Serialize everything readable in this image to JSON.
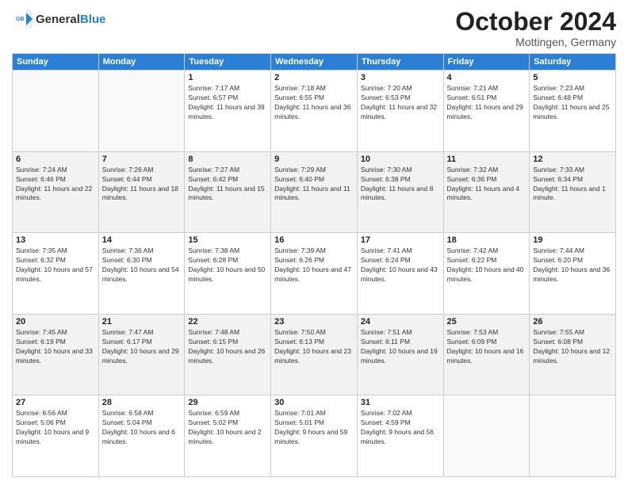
{
  "header": {
    "logo_general": "General",
    "logo_blue": "Blue",
    "month_title": "October 2024",
    "location": "Mottingen, Germany"
  },
  "weekdays": [
    "Sunday",
    "Monday",
    "Tuesday",
    "Wednesday",
    "Thursday",
    "Friday",
    "Saturday"
  ],
  "weeks": [
    [
      {
        "day": "",
        "sunrise": "",
        "sunset": "",
        "daylight": ""
      },
      {
        "day": "",
        "sunrise": "",
        "sunset": "",
        "daylight": ""
      },
      {
        "day": "1",
        "sunrise": "Sunrise: 7:17 AM",
        "sunset": "Sunset: 6:57 PM",
        "daylight": "Daylight: 11 hours and 39 minutes."
      },
      {
        "day": "2",
        "sunrise": "Sunrise: 7:18 AM",
        "sunset": "Sunset: 6:55 PM",
        "daylight": "Daylight: 11 hours and 36 minutes."
      },
      {
        "day": "3",
        "sunrise": "Sunrise: 7:20 AM",
        "sunset": "Sunset: 6:53 PM",
        "daylight": "Daylight: 11 hours and 32 minutes."
      },
      {
        "day": "4",
        "sunrise": "Sunrise: 7:21 AM",
        "sunset": "Sunset: 6:51 PM",
        "daylight": "Daylight: 11 hours and 29 minutes."
      },
      {
        "day": "5",
        "sunrise": "Sunrise: 7:23 AM",
        "sunset": "Sunset: 6:48 PM",
        "daylight": "Daylight: 11 hours and 25 minutes."
      }
    ],
    [
      {
        "day": "6",
        "sunrise": "Sunrise: 7:24 AM",
        "sunset": "Sunset: 6:46 PM",
        "daylight": "Daylight: 11 hours and 22 minutes."
      },
      {
        "day": "7",
        "sunrise": "Sunrise: 7:26 AM",
        "sunset": "Sunset: 6:44 PM",
        "daylight": "Daylight: 11 hours and 18 minutes."
      },
      {
        "day": "8",
        "sunrise": "Sunrise: 7:27 AM",
        "sunset": "Sunset: 6:42 PM",
        "daylight": "Daylight: 11 hours and 15 minutes."
      },
      {
        "day": "9",
        "sunrise": "Sunrise: 7:29 AM",
        "sunset": "Sunset: 6:40 PM",
        "daylight": "Daylight: 11 hours and 11 minutes."
      },
      {
        "day": "10",
        "sunrise": "Sunrise: 7:30 AM",
        "sunset": "Sunset: 6:38 PM",
        "daylight": "Daylight: 11 hours and 8 minutes."
      },
      {
        "day": "11",
        "sunrise": "Sunrise: 7:32 AM",
        "sunset": "Sunset: 6:36 PM",
        "daylight": "Daylight: 11 hours and 4 minutes."
      },
      {
        "day": "12",
        "sunrise": "Sunrise: 7:33 AM",
        "sunset": "Sunset: 6:34 PM",
        "daylight": "Daylight: 11 hours and 1 minute."
      }
    ],
    [
      {
        "day": "13",
        "sunrise": "Sunrise: 7:35 AM",
        "sunset": "Sunset: 6:32 PM",
        "daylight": "Daylight: 10 hours and 57 minutes."
      },
      {
        "day": "14",
        "sunrise": "Sunrise: 7:36 AM",
        "sunset": "Sunset: 6:30 PM",
        "daylight": "Daylight: 10 hours and 54 minutes."
      },
      {
        "day": "15",
        "sunrise": "Sunrise: 7:38 AM",
        "sunset": "Sunset: 6:28 PM",
        "daylight": "Daylight: 10 hours and 50 minutes."
      },
      {
        "day": "16",
        "sunrise": "Sunrise: 7:39 AM",
        "sunset": "Sunset: 6:26 PM",
        "daylight": "Daylight: 10 hours and 47 minutes."
      },
      {
        "day": "17",
        "sunrise": "Sunrise: 7:41 AM",
        "sunset": "Sunset: 6:24 PM",
        "daylight": "Daylight: 10 hours and 43 minutes."
      },
      {
        "day": "18",
        "sunrise": "Sunrise: 7:42 AM",
        "sunset": "Sunset: 6:22 PM",
        "daylight": "Daylight: 10 hours and 40 minutes."
      },
      {
        "day": "19",
        "sunrise": "Sunrise: 7:44 AM",
        "sunset": "Sunset: 6:20 PM",
        "daylight": "Daylight: 10 hours and 36 minutes."
      }
    ],
    [
      {
        "day": "20",
        "sunrise": "Sunrise: 7:45 AM",
        "sunset": "Sunset: 6:19 PM",
        "daylight": "Daylight: 10 hours and 33 minutes."
      },
      {
        "day": "21",
        "sunrise": "Sunrise: 7:47 AM",
        "sunset": "Sunset: 6:17 PM",
        "daylight": "Daylight: 10 hours and 29 minutes."
      },
      {
        "day": "22",
        "sunrise": "Sunrise: 7:48 AM",
        "sunset": "Sunset: 6:15 PM",
        "daylight": "Daylight: 10 hours and 26 minutes."
      },
      {
        "day": "23",
        "sunrise": "Sunrise: 7:50 AM",
        "sunset": "Sunset: 6:13 PM",
        "daylight": "Daylight: 10 hours and 23 minutes."
      },
      {
        "day": "24",
        "sunrise": "Sunrise: 7:51 AM",
        "sunset": "Sunset: 6:11 PM",
        "daylight": "Daylight: 10 hours and 19 minutes."
      },
      {
        "day": "25",
        "sunrise": "Sunrise: 7:53 AM",
        "sunset": "Sunset: 6:09 PM",
        "daylight": "Daylight: 10 hours and 16 minutes."
      },
      {
        "day": "26",
        "sunrise": "Sunrise: 7:55 AM",
        "sunset": "Sunset: 6:08 PM",
        "daylight": "Daylight: 10 hours and 12 minutes."
      }
    ],
    [
      {
        "day": "27",
        "sunrise": "Sunrise: 6:56 AM",
        "sunset": "Sunset: 5:06 PM",
        "daylight": "Daylight: 10 hours and 9 minutes."
      },
      {
        "day": "28",
        "sunrise": "Sunrise: 6:58 AM",
        "sunset": "Sunset: 5:04 PM",
        "daylight": "Daylight: 10 hours and 6 minutes."
      },
      {
        "day": "29",
        "sunrise": "Sunrise: 6:59 AM",
        "sunset": "Sunset: 5:02 PM",
        "daylight": "Daylight: 10 hours and 2 minutes."
      },
      {
        "day": "30",
        "sunrise": "Sunrise: 7:01 AM",
        "sunset": "Sunset: 5:01 PM",
        "daylight": "Daylight: 9 hours and 59 minutes."
      },
      {
        "day": "31",
        "sunrise": "Sunrise: 7:02 AM",
        "sunset": "Sunset: 4:59 PM",
        "daylight": "Daylight: 9 hours and 56 minutes."
      },
      {
        "day": "",
        "sunrise": "",
        "sunset": "",
        "daylight": ""
      },
      {
        "day": "",
        "sunrise": "",
        "sunset": "",
        "daylight": ""
      }
    ]
  ]
}
